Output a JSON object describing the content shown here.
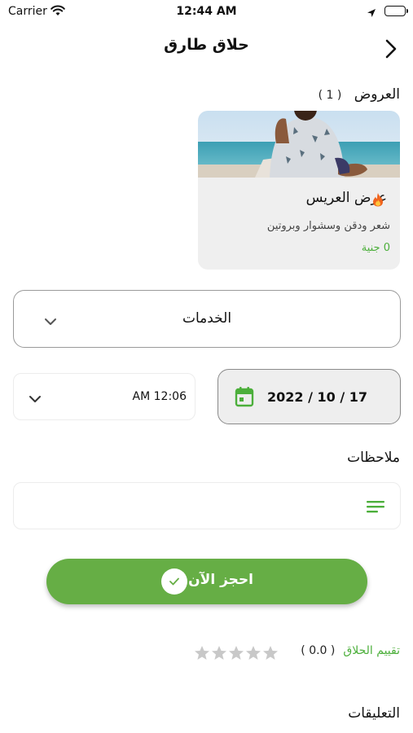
{
  "status_bar": {
    "carrier": "Carrier",
    "time": "12:44 AM"
  },
  "header": {
    "title": "حلاق طارق",
    "back_icon": "chevron-right-icon"
  },
  "offers": {
    "label": "العروض",
    "count": "( 1 )",
    "items": [
      {
        "title": "عرض العريس",
        "icon": "fire-icon",
        "description": "شعر ودقن وسشوار وبروتين",
        "price": "0 جنية"
      }
    ]
  },
  "services": {
    "label": "الخدمات",
    "icon": "chevron-down-icon"
  },
  "booking": {
    "time_value": "12:06 AM",
    "date_value": "2022 / 10 / 17",
    "calendar_icon": "calendar-icon"
  },
  "notes": {
    "label": "ملاحظات",
    "icon": "notes-lines-icon",
    "value": ""
  },
  "book_button": {
    "label": "احجز الآن",
    "icon": "check-icon"
  },
  "rating": {
    "label": "تقييم الحلاق",
    "value": "( 0.0 )",
    "stars": 0,
    "max_stars": 5
  },
  "comments": {
    "label": "التعليقات"
  },
  "colors": {
    "accent": "#66ae45",
    "accent_text": "#4caf3b",
    "card_bg": "#efefef",
    "star_empty": "#c8c8c8"
  }
}
